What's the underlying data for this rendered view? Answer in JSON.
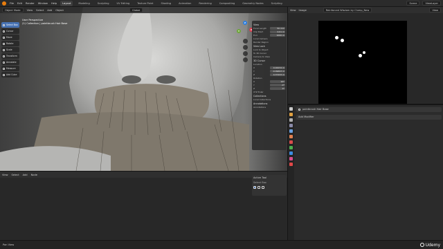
{
  "topbar": {
    "menus": [
      "File",
      "Edit",
      "Render",
      "Window",
      "Help"
    ],
    "workspaces": [
      "Layout",
      "Modeling",
      "Sculpting",
      "UV Editing",
      "Texture Paint",
      "Shading",
      "Animation",
      "Rendering",
      "Compositing",
      "Geometry Nodes",
      "Scripting"
    ],
    "active_workspace": "Layout",
    "scene": "Scene",
    "view_layer": "ViewLayer"
  },
  "viewport": {
    "mode": "Object Mode",
    "menus": [
      "View",
      "Select",
      "Add",
      "Object"
    ],
    "orientation": "Global",
    "perspective_title": "User Perspective",
    "object_label": "(1) Collection | paintbrush Hair Base",
    "tools": [
      "Select Box",
      "Cursor",
      "Move",
      "Rotate",
      "Scale",
      "Transform",
      "Annotate",
      "Measure",
      "Add Cube"
    ],
    "gizmo_axes": [
      "X",
      "Y",
      "Z"
    ]
  },
  "npanel": {
    "view_section": "View",
    "focal_length_label": "Focal Length",
    "focal_length": "50 mm",
    "clip_start_label": "Clip Start",
    "clip_start": "0.01 m",
    "clip_end_label": "End",
    "clip_end": "1000 m",
    "local_camera": "Local Camera",
    "render_region": "Render Region",
    "view_lock": "View Lock",
    "lock_to_object": "Lock to Object",
    "lock_to_3d_cursor": "To 3D Cursor",
    "lock_camera": "Camera to View",
    "cursor_section": "3D Cursor",
    "location_label": "Location",
    "loc_x": "0.04234 m",
    "loc_y": "-0.09693 m",
    "loc_z": "0.37433 m",
    "rotation_label": "Rotation",
    "rot_x": "90°",
    "rot_y": "-0°",
    "rot_z": "0°",
    "rotation_mode": "XYZ Euler",
    "collections_section": "Collections",
    "local_collections": "Local Collections",
    "annotations_section": "Annotations",
    "annotation_name": "Annotations"
  },
  "lower_editor": {
    "menus": [
      "View",
      "Select",
      "Add",
      "Node"
    ],
    "active_tool": "Active Tool",
    "select_box": "Select Box"
  },
  "image_editor": {
    "menus": [
      "View",
      "Image"
    ],
    "image_name": "Reinforced Wisdom by Clump_New",
    "view": "View"
  },
  "properties": {
    "object_name": "paintbrush Hair Base",
    "add_modifier": "Add Modifier",
    "tab_colors": [
      "#c8c8c8",
      "#e0a040",
      "#b0b0b0",
      "#8a8aa8",
      "#6aa0e0",
      "#e08050",
      "#d84c4c",
      "#4caf50",
      "#3c8ce0",
      "#d84c8c",
      "#e04848"
    ]
  },
  "status": {
    "left": "Pan View",
    "brand": "Udemy"
  }
}
